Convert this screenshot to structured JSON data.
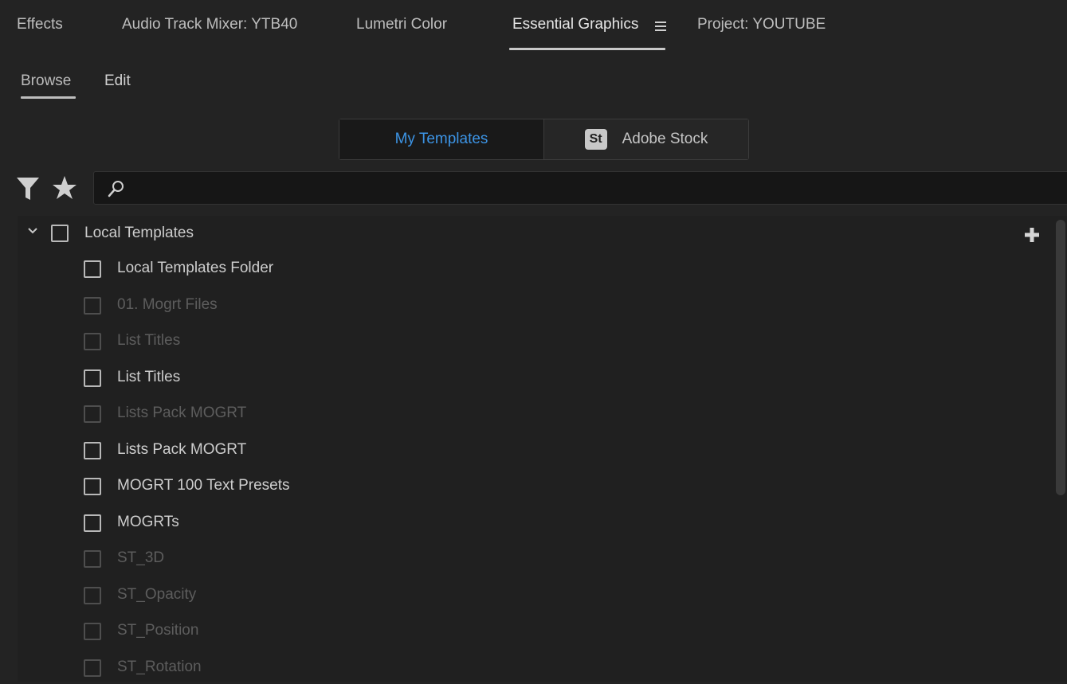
{
  "panel_tabs": [
    {
      "label": "Effects"
    },
    {
      "label": "Audio Track Mixer: YTB40"
    },
    {
      "label": "Lumetri Color"
    },
    {
      "label": "Essential Graphics"
    },
    {
      "label": "Project: YOUTUBE"
    }
  ],
  "active_panel_tab": "Essential Graphics",
  "subtabs": [
    {
      "label": "Browse"
    },
    {
      "label": "Edit"
    }
  ],
  "active_subtab": "Browse",
  "source_toggle": {
    "my_templates": "My Templates",
    "adobe_stock_logo": "St",
    "adobe_stock": "Adobe Stock",
    "selected": "My Templates"
  },
  "search": {
    "value": "",
    "placeholder": ""
  },
  "tree": {
    "root": {
      "label": "Local Templates",
      "expanded": true,
      "checked": false
    },
    "items": [
      {
        "label": "Local Templates Folder",
        "enabled": true,
        "checked": false
      },
      {
        "label": "01. Mogrt Files",
        "enabled": false,
        "checked": false
      },
      {
        "label": "List Titles",
        "enabled": false,
        "checked": false
      },
      {
        "label": "List Titles",
        "enabled": true,
        "checked": false
      },
      {
        "label": "Lists Pack MOGRT",
        "enabled": false,
        "checked": false
      },
      {
        "label": "Lists Pack MOGRT",
        "enabled": true,
        "checked": false
      },
      {
        "label": "MOGRT 100 Text Presets",
        "enabled": true,
        "checked": false
      },
      {
        "label": "MOGRTs",
        "enabled": true,
        "checked": false
      },
      {
        "label": "ST_3D",
        "enabled": false,
        "checked": false
      },
      {
        "label": "ST_Opacity",
        "enabled": false,
        "checked": false
      },
      {
        "label": "ST_Position",
        "enabled": false,
        "checked": false
      },
      {
        "label": "ST_Rotation",
        "enabled": false,
        "checked": false
      }
    ]
  },
  "colors": {
    "accent": "#3c94e5",
    "background": "#232323"
  },
  "icons": [
    "menu-icon",
    "filter-icon",
    "star-icon",
    "search-icon",
    "chevron-down-icon",
    "plus-icon"
  ]
}
